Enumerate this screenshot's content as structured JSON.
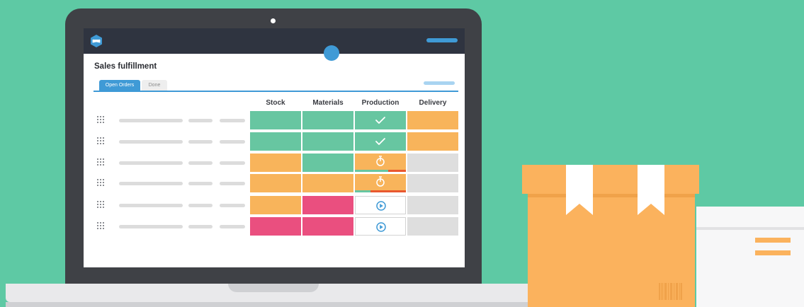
{
  "colors": {
    "background": "#5ec9a4",
    "laptop_bezel": "#3f4146",
    "laptop_base": "#e9e9eb",
    "laptop_base_shadow": "#cfd0d3",
    "topbar": "#2f3440",
    "accent_blue": "#3f9ad6",
    "light_blue": "#a9d4f1",
    "placeholder": "#dcdcdc",
    "green": "#67c6a1",
    "orange": "#f8b45b",
    "pink": "#ea4f7f",
    "gray": "#dedede",
    "red_progress": "#e9582f",
    "box_light": "#fbb25d",
    "box_dark": "#f0a24a",
    "white": "#ffffff",
    "card": "#f7f7f8",
    "card_line": "#e2e2e4"
  },
  "app": {
    "logo": "app-logo-icon",
    "title": "Sales fulfillment",
    "tabs": [
      {
        "label": "Open Orders",
        "active": true
      },
      {
        "label": "Done",
        "active": false
      }
    ],
    "columns": [
      "Stock",
      "Materials",
      "Production",
      "Delivery"
    ]
  },
  "rows": [
    {
      "stock": "green",
      "materials": "green",
      "production": {
        "state": "done",
        "icon": "check-icon",
        "color": "green"
      },
      "delivery": "orange"
    },
    {
      "stock": "green",
      "materials": "green",
      "production": {
        "state": "done",
        "icon": "check-icon",
        "color": "green"
      },
      "delivery": "orange"
    },
    {
      "stock": "orange",
      "materials": "green",
      "production": {
        "state": "in-progress",
        "icon": "timer-icon",
        "color": "orange",
        "progress": 0.65
      },
      "delivery": "gray"
    },
    {
      "stock": "orange",
      "materials": "orange",
      "production": {
        "state": "in-progress",
        "icon": "timer-icon",
        "color": "orange",
        "progress": 0.3
      },
      "delivery": "gray"
    },
    {
      "stock": "orange",
      "materials": "pink",
      "production": {
        "state": "ready",
        "icon": "play-icon",
        "color": "white"
      },
      "delivery": "gray"
    },
    {
      "stock": "pink",
      "materials": "pink",
      "production": {
        "state": "ready",
        "icon": "play-icon",
        "color": "white"
      },
      "delivery": "gray"
    }
  ]
}
